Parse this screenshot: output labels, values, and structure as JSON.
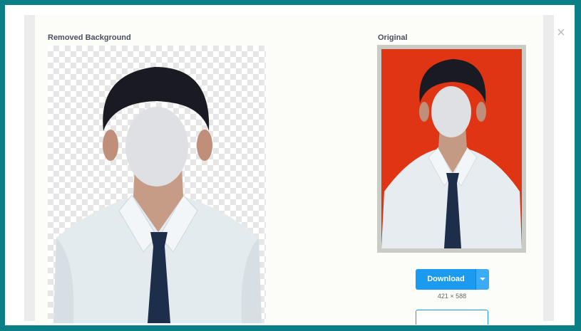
{
  "left_panel": {
    "title": "Removed Background"
  },
  "right_panel": {
    "title": "Original"
  },
  "close": {
    "icon": "close-icon",
    "glyph": "×"
  },
  "download": {
    "label": "Download",
    "dropdown_icon": "caret-down-icon",
    "dimensions": "421 × 588"
  },
  "colors": {
    "frame": "#0b7f86",
    "original_background": "#df3514",
    "accent_button": "#1a9bf0",
    "shirt": "#e4ebef",
    "tie": "#1c2e4a",
    "hair": "#1a1b22"
  }
}
